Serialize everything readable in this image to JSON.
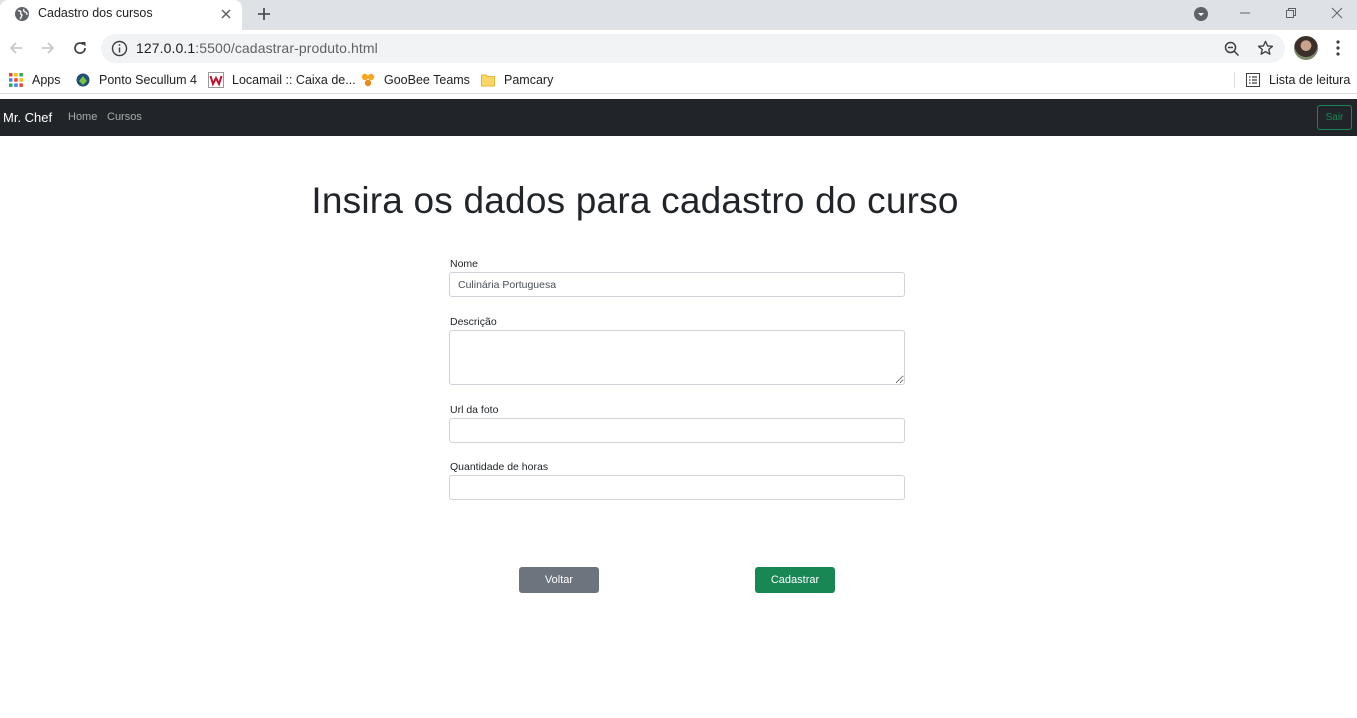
{
  "browser": {
    "tab": {
      "title": "Cadastro dos cursos",
      "favicon": "globe-icon"
    },
    "url": {
      "host": "127.0.0.1",
      "rest": ":5500/cadastrar-produto.html"
    },
    "bookmarks": [
      {
        "label": "Apps",
        "icon": "apps-grid-icon"
      },
      {
        "label": "Ponto Secullum 4",
        "icon": "secullum-icon"
      },
      {
        "label": "Locamail :: Caixa de...",
        "icon": "locamail-icon"
      },
      {
        "label": "GooBee Teams",
        "icon": "goobee-icon"
      },
      {
        "label": "Pamcary",
        "icon": "folder-icon"
      }
    ],
    "reading_list": "Lista de leitura"
  },
  "navbar": {
    "brand": "Mr. Chef",
    "links": [
      "Home",
      "Cursos"
    ],
    "logout": "Sair"
  },
  "main": {
    "title": "Insira os dados para cadastro do curso",
    "fields": {
      "nome": {
        "label": "Nome",
        "value": "Culinária Portuguesa"
      },
      "descricao": {
        "label": "Descrição",
        "value": ""
      },
      "url_foto": {
        "label": "Url da foto",
        "value": ""
      },
      "horas": {
        "label": "Quantidade de horas",
        "value": ""
      }
    },
    "buttons": {
      "back": "Voltar",
      "submit": "Cadastrar"
    }
  },
  "colors": {
    "navbar": "#212529",
    "success": "#198754",
    "secondary": "#6c757d"
  }
}
